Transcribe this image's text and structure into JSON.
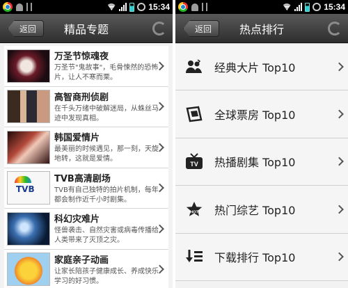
{
  "status_bar": {
    "time": "15:34"
  },
  "left_screen": {
    "back_label": "返回",
    "title": "精品专题",
    "items": [
      {
        "title": "万圣节惊魂夜",
        "desc": "万圣节\"鬼故事\"，毛骨悚然的恐怖片，让人不寒而栗。"
      },
      {
        "title": "高智商刑侦剧",
        "desc": "在千头万绪中破解迷局，从蛛丝马迹中发现真相。"
      },
      {
        "title": "韩国爱情片",
        "desc": "最美丽的时候遇见，那一刻，天旋地转，这就是爱情。"
      },
      {
        "title": "TVB高清剧场",
        "desc": "TVB有自己独特的拍片机制，每年都会制作近千小时剧集。"
      },
      {
        "title": "科幻灾难片",
        "desc": "怪兽袭击、自然灾害或病毒传播给人类带来了灭顶之灾。"
      },
      {
        "title": "家庭亲子动画",
        "desc": "让家长陪孩子健康成长、养成快乐学习的好习惯。"
      }
    ]
  },
  "right_screen": {
    "back_label": "返回",
    "title": "热点排行",
    "items": [
      {
        "label": "经典大片 Top10",
        "icon": "people-icon"
      },
      {
        "label": "全球票房 Top10",
        "icon": "film-ticket-icon"
      },
      {
        "label": "热播剧集 Top10",
        "icon": "tv-icon"
      },
      {
        "label": "热门综艺 Top10",
        "icon": "hot-star-icon"
      },
      {
        "label": "下载排行 Top10",
        "icon": "download-list-icon"
      }
    ]
  },
  "colors": {
    "titlebar_top": "#595959",
    "titlebar_bottom": "#2e2e2e",
    "list_bg": "#ffffff",
    "status_bar": "#000000"
  }
}
